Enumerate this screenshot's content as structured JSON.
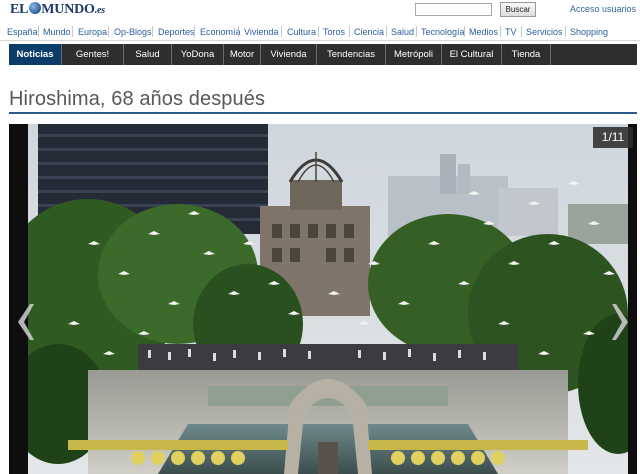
{
  "header": {
    "logo_part1": "EL",
    "logo_part2": "MUNDO",
    "logo_tld": ".es",
    "search_placeholder": "",
    "search_button": "Buscar",
    "login_link": "Acceso usuarios"
  },
  "sections": [
    "España",
    "Mundo",
    "Europa",
    "Op-Blogs",
    "Deportes",
    "Economía",
    "Vivienda",
    "Cultura",
    "Toros",
    "Ciencia",
    "Salud",
    "Tecnología",
    "Medios",
    "TV",
    "Servicios",
    "Shopping"
  ],
  "nav_tabs": [
    "Noticias",
    "Gentes!",
    "Salud",
    "YoDona",
    "Motor",
    "Vivienda",
    "Tendencias",
    "Metrópoli",
    "El Cultural",
    "Tienda"
  ],
  "active_tab": "Noticias",
  "article": {
    "title": "Hiroshima, 68 años después"
  },
  "gallery": {
    "counter": "1/11",
    "prev_icon": "chevron-left-icon",
    "next_icon": "chevron-right-icon"
  },
  "colors": {
    "link": "#2a5f9e",
    "nav_bg": "#2e2e2e",
    "nav_active": "#0c3c6a",
    "title_rule": "#2a5a88"
  }
}
